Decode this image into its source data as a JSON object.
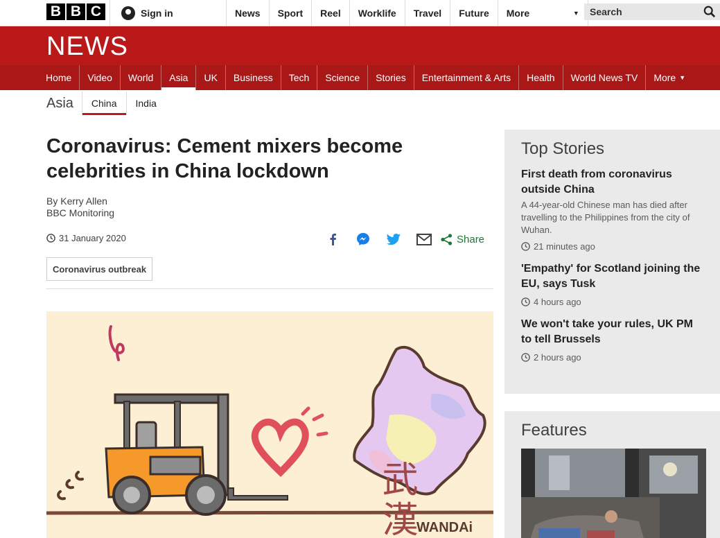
{
  "header": {
    "logo_letters": [
      "B",
      "B",
      "C"
    ],
    "signin_label": "Sign in",
    "nav": [
      "News",
      "Sport",
      "Reel",
      "Worklife",
      "Travel",
      "Future"
    ],
    "more_label": "More",
    "search_label": "Search"
  },
  "banner": {
    "title": "NEWS"
  },
  "news_nav": {
    "items": [
      "Home",
      "Video",
      "World",
      "Asia",
      "UK",
      "Business",
      "Tech",
      "Science",
      "Stories",
      "Entertainment & Arts",
      "Health",
      "World News TV"
    ],
    "active": "Asia",
    "more_label": "More"
  },
  "subnav": {
    "section": "Asia",
    "items": [
      "China",
      "India"
    ],
    "active": "China"
  },
  "article": {
    "headline": "Coronavirus: Cement mixers become celebrities in China lockdown",
    "author": "By Kerry Allen",
    "author_org": "BBC Monitoring",
    "date": "31 January 2020",
    "share_label": "Share",
    "tag": "Coronavirus outbreak",
    "image_signature": "WANDAi",
    "image_characters": "武漢"
  },
  "sidebar": {
    "top_stories_title": "Top Stories",
    "stories": [
      {
        "title": "First death from coronavirus outside China",
        "summary": "A 44-year-old Chinese man has died after travelling to the Philippines from the city of Wuhan.",
        "time": "21 minutes ago"
      },
      {
        "title": "'Empathy' for Scotland joining the EU, says Tusk",
        "summary": "",
        "time": "4 hours ago"
      },
      {
        "title": "We won't take your rules, UK PM to tell Brussels",
        "summary": "",
        "time": "2 hours ago"
      }
    ],
    "features_title": "Features"
  },
  "colors": {
    "brand_red": "#bb1919",
    "nav_red": "#a91717",
    "share_green": "#1a7a33",
    "sidebar_bg": "#eaeaea"
  }
}
